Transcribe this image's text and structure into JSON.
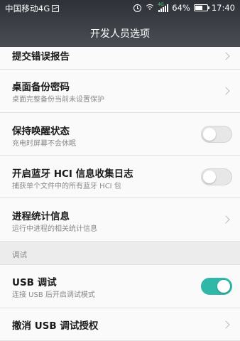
{
  "status_bar": {
    "carrier": "中国移动4G",
    "battery": "64%",
    "time": "17:40",
    "icons": [
      "image-icon",
      "alarm-icon",
      "wifi-icon",
      "signal-4g-icon",
      "battery-icon"
    ]
  },
  "header": {
    "title": "开发人员选项"
  },
  "rows": [
    {
      "title": "提交错误报告",
      "type": "link"
    },
    {
      "title": "桌面备份密码",
      "subtitle": "桌面完整备份当前未设置保护",
      "type": "link"
    },
    {
      "title": "保持唤醒状态",
      "subtitle": "充电时屏幕不会休眠",
      "type": "toggle",
      "on": false
    },
    {
      "title": "开启蓝牙 HCI 信息收集日志",
      "subtitle": "捕获单个文件中的所有蓝牙 HCI 包",
      "type": "toggle",
      "on": false
    },
    {
      "title": "进程统计信息",
      "subtitle": "运行中进程的相关统计信息",
      "type": "link"
    }
  ],
  "debug_section": {
    "label": "调试"
  },
  "debug_rows": [
    {
      "title": "USB 调试",
      "subtitle": "连接 USB 后开启调试模式",
      "type": "toggle",
      "on": true
    },
    {
      "title": "撤消 USB 调试授权",
      "type": "link"
    }
  ],
  "colors": {
    "accent": "#2fb7a8",
    "header": "#3d4147"
  }
}
